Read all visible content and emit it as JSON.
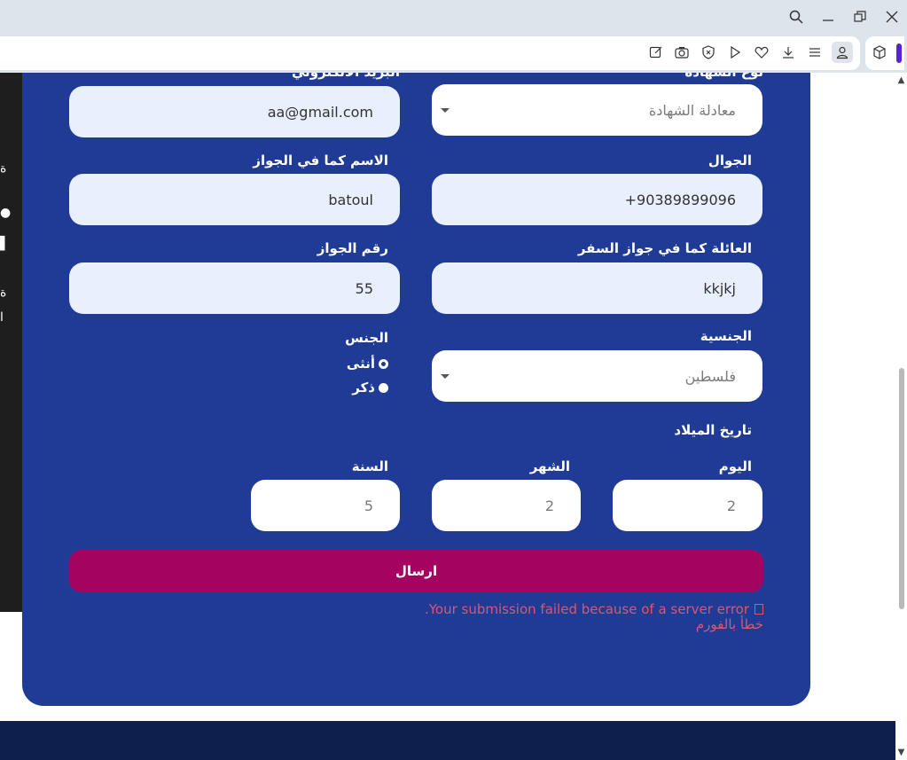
{
  "window": {
    "controls": [
      "search-icon",
      "minimize-icon",
      "restore-icon",
      "close-icon"
    ]
  },
  "toolbar": {
    "icons": [
      "edit-icon",
      "camera-icon",
      "shield-icon",
      "play-icon",
      "heart-icon",
      "download-icon",
      "menu-icon",
      "profile-icon",
      "extension-icon"
    ]
  },
  "left_panel": {
    "chars": [
      "ة",
      "ا",
      "ة",
      "ا"
    ]
  },
  "form": {
    "email_label": "البريد الالكتروني",
    "email_value": "aa@gmail.com",
    "cert_label": "نوع الشهادة",
    "cert_value": "معادلة الشهادة",
    "passport_name_label": "الاسم كما في الجواز",
    "passport_name_value": "batoul",
    "mobile_label": "الجوال",
    "mobile_value": "+90389899096",
    "passport_no_label": "رقم الجواز",
    "passport_no_value": "55",
    "family_label": "العائلة كما في جواز السفر",
    "family_value": "kkjkj",
    "gender_label": "الجنس",
    "gender_female": "أنثى",
    "gender_male": "ذكر",
    "nationality_label": "الجنسية",
    "nationality_value": "فلسطين",
    "dob_label": "تاريخ الميلاد",
    "day_label": "اليوم",
    "day_value": "2",
    "month_label": "الشهر",
    "month_value": "2",
    "year_label": "السنة",
    "year_value": "5",
    "submit_label": "ارسال",
    "error_en": "Your submission failed because of a server error.",
    "error_ar": "خطأ بالفورم"
  },
  "colors": {
    "form_bg": "#1f3b95",
    "submit_bg": "#a4045f",
    "error_text": "#e0556d",
    "footer_bg": "#0e1f4e"
  }
}
